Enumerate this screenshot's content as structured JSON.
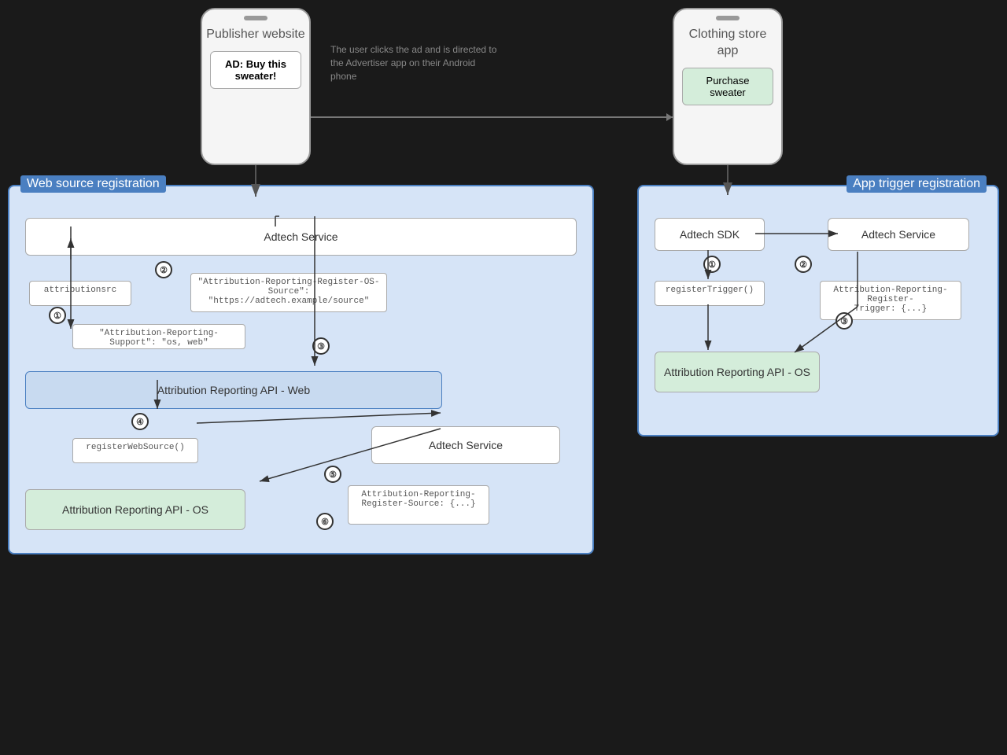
{
  "publisher_phone": {
    "title": "Publisher\nwebsite",
    "ad_label": "AD:\nBuy this\nsweater!"
  },
  "clothing_phone": {
    "title": "Clothing store\napp",
    "purchase_label": "Purchase\nsweater"
  },
  "arrow_label": "The user clicks the ad and is\ndirected to the Advertiser app on\ntheir Android phone",
  "web_source_box": {
    "title": "Web source registration",
    "adtech_service_top": "Adtech Service",
    "attributionsrc": "attributionsrc",
    "attribution_support": "\"Attribution-Reporting-Support\": \"os, web\"",
    "attribution_register_source": "\"Attribution-Reporting-Register-OS-Source\":\n\"https://adtech.example/source\"",
    "attribution_reporting_web": "Attribution Reporting API - Web",
    "register_web_source": "registerWebSource()",
    "adtech_service_bottom": "Adtech Service",
    "attribution_register_source2": "Attribution-Reporting-\nRegister-Source: {...}",
    "attribution_reporting_os": "Attribution Reporting API - OS",
    "steps": [
      "①",
      "②",
      "③",
      "④",
      "⑤",
      "⑥"
    ]
  },
  "app_trigger_box": {
    "title": "App trigger registration",
    "adtech_sdk": "Adtech SDK",
    "register_trigger": "registerTrigger()",
    "adtech_service": "Adtech Service",
    "attribution_register_trigger": "Attribution-Reporting-Register-\nTrigger: {...}",
    "attribution_reporting_os": "Attribution Reporting API - OS",
    "steps": [
      "①",
      "②",
      "③"
    ]
  }
}
